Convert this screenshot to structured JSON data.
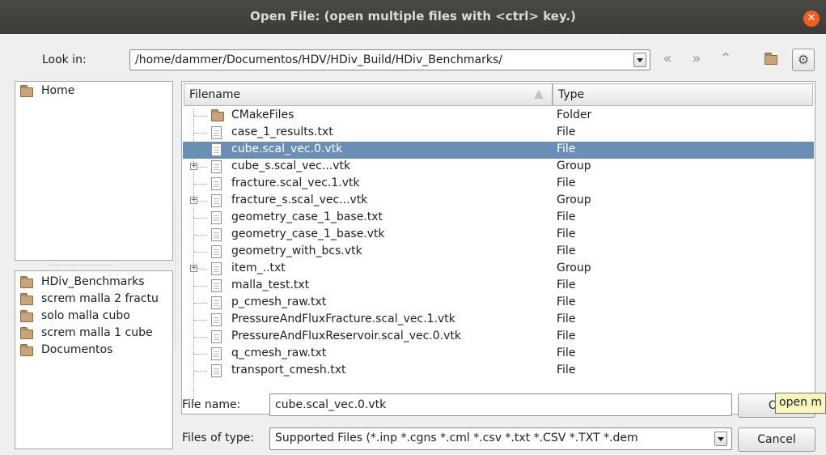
{
  "window": {
    "title": "Open File:  (open multiple files with <ctrl> key.)"
  },
  "look_in": {
    "label": "Look in:",
    "path": "/home/dammer/Documentos/HDV/HDiv_Build/HDiv_Benchmarks/"
  },
  "toolbar": {
    "back_icon": "back-arrow-icon",
    "forward_icon": "forward-arrow-icon",
    "up_icon": "parent-directory-icon",
    "new_folder_icon": "new-folder-icon",
    "settings_icon": "gear-icon"
  },
  "places_top": [
    {
      "label": "Home"
    }
  ],
  "places_bottom": [
    {
      "label": "HDiv_Benchmarks"
    },
    {
      "label": "screm malla 2 fractu"
    },
    {
      "label": "solo malla cubo"
    },
    {
      "label": "screm malla 1 cube"
    },
    {
      "label": "Documentos"
    }
  ],
  "file_list": {
    "columns": [
      "Filename",
      "Type"
    ],
    "rows": [
      {
        "name": "CMakeFiles",
        "type": "Folder",
        "icon": "folder-icon",
        "expandable": false,
        "selected": false
      },
      {
        "name": "case_1_results.txt",
        "type": "File",
        "icon": "file-icon",
        "expandable": false,
        "selected": false
      },
      {
        "name": "cube.scal_vec.0.vtk",
        "type": "File",
        "icon": "file-icon",
        "expandable": false,
        "selected": true
      },
      {
        "name": "cube_s.scal_vec...vtk",
        "type": "Group",
        "icon": "file-icon",
        "expandable": true,
        "selected": false
      },
      {
        "name": "fracture.scal_vec.1.vtk",
        "type": "File",
        "icon": "file-icon",
        "expandable": false,
        "selected": false
      },
      {
        "name": "fracture_s.scal_vec...vtk",
        "type": "Group",
        "icon": "file-icon",
        "expandable": true,
        "selected": false
      },
      {
        "name": "geometry_case_1_base.txt",
        "type": "File",
        "icon": "file-icon",
        "expandable": false,
        "selected": false
      },
      {
        "name": "geometry_case_1_base.vtk",
        "type": "File",
        "icon": "file-icon",
        "expandable": false,
        "selected": false
      },
      {
        "name": "geometry_with_bcs.vtk",
        "type": "File",
        "icon": "file-icon",
        "expandable": false,
        "selected": false
      },
      {
        "name": "item_..txt",
        "type": "Group",
        "icon": "file-icon",
        "expandable": true,
        "selected": false
      },
      {
        "name": "malla_test.txt",
        "type": "File",
        "icon": "file-icon",
        "expandable": false,
        "selected": false
      },
      {
        "name": "p_cmesh_raw.txt",
        "type": "File",
        "icon": "file-icon",
        "expandable": false,
        "selected": false
      },
      {
        "name": "PressureAndFluxFracture.scal_vec.1.vtk",
        "type": "File",
        "icon": "file-icon",
        "expandable": false,
        "selected": false
      },
      {
        "name": "PressureAndFluxReservoir.scal_vec.0.vtk",
        "type": "File",
        "icon": "file-icon",
        "expandable": false,
        "selected": false
      },
      {
        "name": "q_cmesh_raw.txt",
        "type": "File",
        "icon": "file-icon",
        "expandable": false,
        "selected": false
      },
      {
        "name": "transport_cmesh.txt",
        "type": "File",
        "icon": "file-icon",
        "expandable": false,
        "selected": false
      }
    ]
  },
  "file_name": {
    "label": "File name:",
    "value": "cube.scal_vec.0.vtk"
  },
  "file_type": {
    "label": "Files of type:",
    "value": "Supported Files (*.inp  *.cgns  *.cml  *.csv *.txt *.CSV *.TXT  *.dem"
  },
  "buttons": {
    "ok": "OK",
    "cancel": "Cancel"
  },
  "tooltip": {
    "text": "open m"
  },
  "colors": {
    "selection": "#6b8fb4",
    "titlebar": "#3c3b37",
    "close": "#f15d22"
  }
}
